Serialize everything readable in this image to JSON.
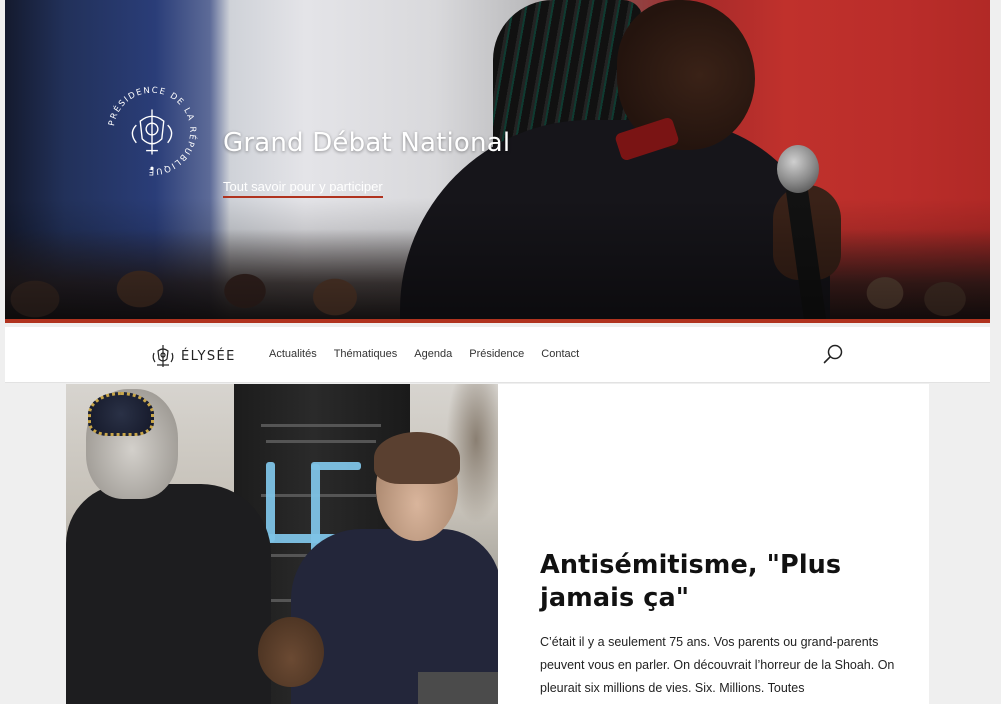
{
  "hero": {
    "title": "Grand Débat National",
    "link": "Tout savoir pour y participer",
    "seal_text": "PRÉSIDENCE DE LA RÉPUBLIQUE"
  },
  "nav": {
    "brand": "ÉLYSÉE",
    "items": [
      {
        "label": "Actualités"
      },
      {
        "label": "Thématiques"
      },
      {
        "label": "Agenda"
      },
      {
        "label": "Présidence"
      },
      {
        "label": "Contact"
      }
    ]
  },
  "article": {
    "title": "Antisémitisme, \"Plus jamais ça\"",
    "body": "C’était il y a seulement 75 ans. Vos parents ou grand-parents peuvent vous en parler. On découvrait l’horreur de la Shoah. On pleurait six millions de vies. Six. Millions. Toutes"
  },
  "icons": {
    "seal": "presidential-seal-icon",
    "brand": "elysee-emblem-icon",
    "search": "search-icon"
  },
  "colors": {
    "accent": "#b0331f",
    "hero_text": "#ffffff",
    "nav_background": "#ffffff",
    "page_background": "#efefef"
  }
}
